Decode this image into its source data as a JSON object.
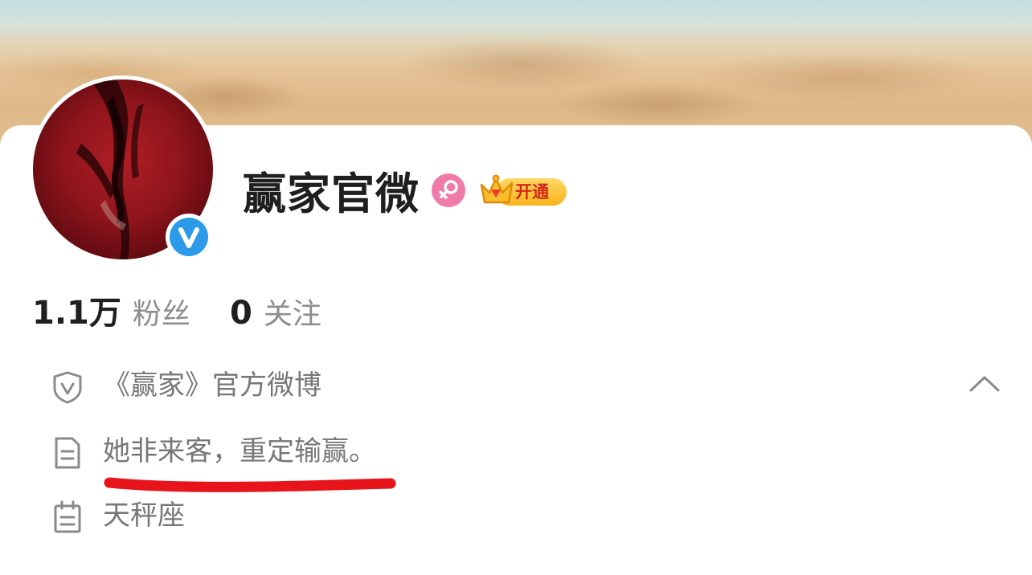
{
  "profile": {
    "name": "赢家官微",
    "verified_mark": "V",
    "gender_icon": "female-icon",
    "vip_badge_label": "开通",
    "vip_badge_color": "#f8b31c"
  },
  "stats": {
    "followers_count": "1.1万",
    "followers_label": "粉丝",
    "following_count": "0",
    "following_label": "关注"
  },
  "info": {
    "verification": "《赢家》官方微博",
    "bio": "她非来客，重定输赢。",
    "zodiac": "天秤座"
  },
  "colors": {
    "verified_blue": "#2b9ae8",
    "female_pink": "#f07ba8",
    "annotation_red": "#e8141c",
    "secondary_text": "#8d8d8d"
  }
}
